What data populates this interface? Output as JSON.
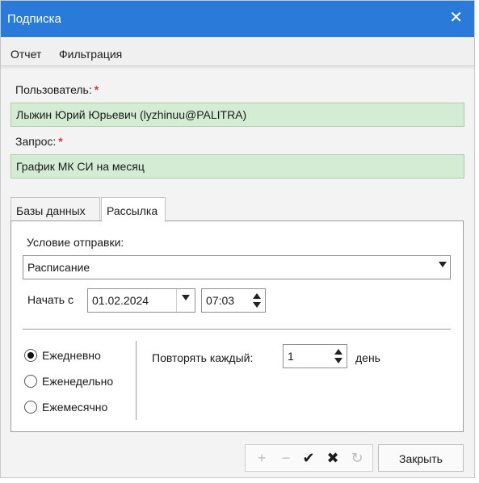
{
  "window": {
    "title": "Подписка",
    "close_glyph": "✕"
  },
  "menu": {
    "items": [
      "Отчет",
      "Фильтрация"
    ]
  },
  "form": {
    "user_label": "Пользователь:",
    "user_value": "Лыжин Юрий Юрьевич (lyzhinuu@PALITRA)",
    "query_label": "Запрос:",
    "query_value": "График МК СИ на месяц",
    "required_mark": "*"
  },
  "tabs": [
    {
      "label": "Базы данных",
      "active": false
    },
    {
      "label": "Рассылка",
      "active": true
    }
  ],
  "mailing": {
    "condition_label": "Условие отправки:",
    "condition_value": "Расписание",
    "start_label": "Начать с",
    "start_date": "01.02.2024",
    "start_time": "07:03",
    "frequency_options": [
      {
        "label": "Ежедневно",
        "checked": true
      },
      {
        "label": "Еженедельно",
        "checked": false
      },
      {
        "label": "Ежемесячно",
        "checked": false
      }
    ],
    "repeat_label": "Повторять каждый:",
    "repeat_value": "1",
    "repeat_unit": "день"
  },
  "toolbar": {
    "add_glyph": "+",
    "remove_glyph": "−",
    "apply_glyph": "✔",
    "cancel_glyph": "✖",
    "refresh_glyph": "↻",
    "close_label": "Закрыть"
  },
  "colors": {
    "titlebar": "#2a7bd9",
    "required": "#d83b3b",
    "green_field": "#d4ecd4"
  }
}
